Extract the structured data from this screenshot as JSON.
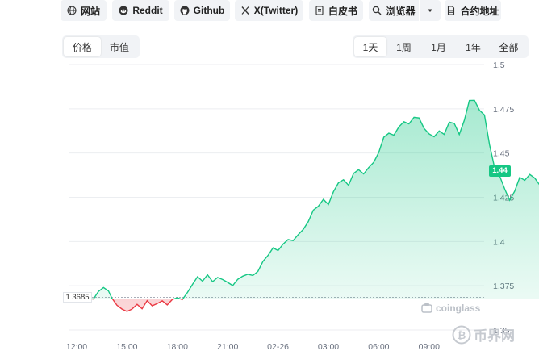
{
  "links": [
    {
      "label": "网站",
      "icon": "globe-icon"
    },
    {
      "label": "Reddit",
      "icon": "reddit-icon"
    },
    {
      "label": "Github",
      "icon": "github-icon"
    },
    {
      "label": "X(Twitter)",
      "icon": "x-icon"
    },
    {
      "label": "白皮书",
      "icon": "document-icon"
    },
    {
      "label": "浏览器",
      "icon": "search-icon"
    },
    {
      "label": "合约地址",
      "icon": "contract-icon"
    }
  ],
  "metric_tabs": [
    {
      "label": "价格",
      "active": true
    },
    {
      "label": "市值",
      "active": false
    }
  ],
  "range_tabs": [
    {
      "label": "1天",
      "active": true
    },
    {
      "label": "1周",
      "active": false
    },
    {
      "label": "1月",
      "active": false
    },
    {
      "label": "1年",
      "active": false
    },
    {
      "label": "全部",
      "active": false
    }
  ],
  "chart_data": {
    "type": "area",
    "x_ticks": [
      "12:00",
      "15:00",
      "18:00",
      "21:00",
      "02-26",
      "03:00",
      "06:00",
      "09:00"
    ],
    "y_ticks": [
      "1.5",
      "1.475",
      "1.45",
      "1.425",
      "1.4",
      "1.375",
      "1.35"
    ],
    "ylim": [
      1.35,
      1.5
    ],
    "grid": true,
    "reference_value": "1.3685",
    "current_value": "1.44",
    "colors": {
      "up": "#16c784",
      "down": "#ea3943"
    },
    "points": [
      [
        0,
        1.3665
      ],
      [
        0.5,
        1.368
      ],
      [
        1,
        1.3675
      ],
      [
        1.3,
        1.3718
      ],
      [
        1.6,
        1.374
      ],
      [
        1.9,
        1.372
      ],
      [
        2.1,
        1.368
      ],
      [
        2.4,
        1.364
      ],
      [
        2.7,
        1.3618
      ],
      [
        3.0,
        1.3605
      ],
      [
        3.3,
        1.3618
      ],
      [
        3.6,
        1.3645
      ],
      [
        3.9,
        1.362
      ],
      [
        4.2,
        1.3666
      ],
      [
        4.5,
        1.3637
      ],
      [
        4.8,
        1.3649
      ],
      [
        5.1,
        1.3665
      ],
      [
        5.4,
        1.3642
      ],
      [
        5.7,
        1.3673
      ],
      [
        6.0,
        1.3682
      ],
      [
        6.3,
        1.3672
      ],
      [
        6.6,
        1.3712
      ],
      [
        6.9,
        1.3757
      ],
      [
        7.2,
        1.3801
      ],
      [
        7.5,
        1.3776
      ],
      [
        7.8,
        1.3812
      ],
      [
        8.1,
        1.3773
      ],
      [
        8.4,
        1.3797
      ],
      [
        8.7,
        1.3785
      ],
      [
        9.0,
        1.3769
      ],
      [
        9.3,
        1.3751
      ],
      [
        9.6,
        1.3787
      ],
      [
        9.9,
        1.3804
      ],
      [
        10.2,
        1.3815
      ],
      [
        10.5,
        1.3808
      ],
      [
        10.8,
        1.3831
      ],
      [
        11.1,
        1.3888
      ],
      [
        11.4,
        1.3921
      ],
      [
        11.7,
        1.3964
      ],
      [
        12.0,
        1.3949
      ],
      [
        12.3,
        1.3985
      ],
      [
        12.6,
        1.4011
      ],
      [
        12.9,
        1.4005
      ],
      [
        13.2,
        1.4039
      ],
      [
        13.5,
        1.4068
      ],
      [
        13.8,
        1.4112
      ],
      [
        14.1,
        1.4177
      ],
      [
        14.4,
        1.4199
      ],
      [
        14.7,
        1.4238
      ],
      [
        15.0,
        1.4209
      ],
      [
        15.3,
        1.4281
      ],
      [
        15.6,
        1.4332
      ],
      [
        15.9,
        1.4349
      ],
      [
        16.2,
        1.4318
      ],
      [
        16.5,
        1.4385
      ],
      [
        16.8,
        1.4406
      ],
      [
        17.1,
        1.4382
      ],
      [
        17.4,
        1.4418
      ],
      [
        17.7,
        1.4448
      ],
      [
        18.0,
        1.4503
      ],
      [
        18.3,
        1.4589
      ],
      [
        18.6,
        1.4612
      ],
      [
        18.9,
        1.4601
      ],
      [
        19.2,
        1.4648
      ],
      [
        19.5,
        1.4677
      ],
      [
        19.8,
        1.4665
      ],
      [
        20.1,
        1.4702
      ],
      [
        20.4,
        1.4698
      ],
      [
        20.7,
        1.4639
      ],
      [
        21.0,
        1.4608
      ],
      [
        21.3,
        1.4592
      ],
      [
        21.6,
        1.4625
      ],
      [
        21.9,
        1.4605
      ],
      [
        22.2,
        1.4675
      ],
      [
        22.5,
        1.4667
      ],
      [
        22.8,
        1.4605
      ],
      [
        23.1,
        1.4686
      ],
      [
        23.4,
        1.4797
      ],
      [
        23.7,
        1.4798
      ],
      [
        24.0,
        1.4742
      ],
      [
        24.3,
        1.4715
      ],
      [
        24.6,
        1.4547
      ],
      [
        24.9,
        1.4418
      ],
      [
        25.2,
        1.4371
      ],
      [
        25.5,
        1.4298
      ],
      [
        25.8,
        1.4233
      ],
      [
        26.1,
        1.4285
      ],
      [
        26.4,
        1.4362
      ],
      [
        26.7,
        1.4346
      ],
      [
        27.0,
        1.4379
      ],
      [
        27.3,
        1.4358
      ],
      [
        27.6,
        1.4318
      ],
      [
        27.9,
        1.4275
      ],
      [
        28.2,
        1.4263
      ],
      [
        28.5,
        1.4235
      ],
      [
        28.8,
        1.4259
      ],
      [
        29.1,
        1.4301
      ],
      [
        29.4,
        1.4358
      ],
      [
        29.7,
        1.4401
      ],
      [
        30.0,
        1.4392
      ],
      [
        30.3,
        1.4421
      ],
      [
        30.6,
        1.44
      ]
    ]
  },
  "watermarks": {
    "primary": "coinglass",
    "secondary": "币界网"
  }
}
